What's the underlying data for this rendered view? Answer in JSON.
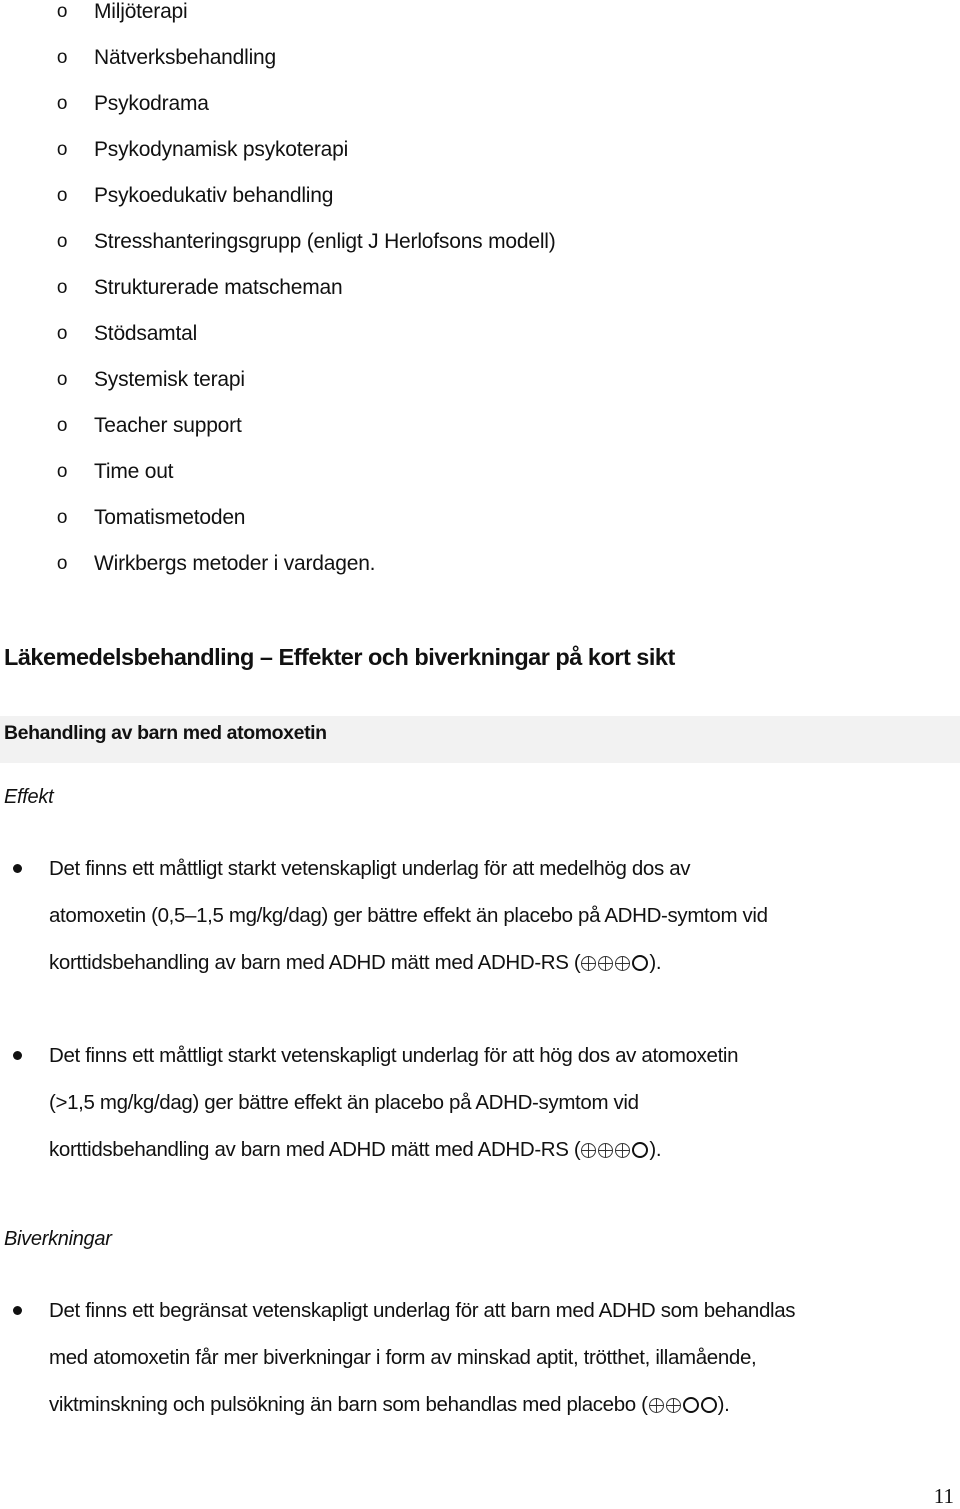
{
  "sublist": {
    "bullet_glyph": "o",
    "items": [
      "Miljöterapi",
      "Nätverksbehandling",
      "Psykodrama",
      "Psykodynamisk psykoterapi",
      "Psykoedukativ behandling",
      "Stresshanteringsgrupp (enligt J Herlofsons modell)",
      "Strukturerade matscheman",
      "Stödsamtal",
      "Systemisk terapi",
      "Teacher support",
      "Time out",
      "Tomatismetoden",
      "Wirkbergs metoder i vardagen."
    ]
  },
  "section": {
    "heading": "Läkemedelsbehandling – Effekter och biverkningar på kort sikt",
    "subheading": "Behandling av barn med atomoxetin",
    "band_color": "#f2f2f2",
    "effekt": {
      "label": "Effekt",
      "bullets": [
        {
          "lines": [
            "Det finns ett måttligt starkt vetenskapligt underlag för att medelhög dos av",
            "atomoxetin (0,5–1,5 mg/kg/dag) ger bättre effekt än placebo på ADHD-symtom vid",
            "korttidsbehandling av barn med ADHD mätt med ADHD-RS ("
          ],
          "evidence_grade": {
            "filled": 3,
            "empty": 1,
            "filled_symbol": "⊕",
            "empty_symbol": "O"
          },
          "suffix": ")."
        },
        {
          "lines": [
            "Det finns ett måttligt starkt vetenskapligt underlag för att hög dos av atomoxetin",
            "(>1,5 mg/kg/dag) ger bättre effekt än placebo på ADHD-symtom vid",
            "korttidsbehandling av barn med ADHD mätt med ADHD-RS ("
          ],
          "evidence_grade": {
            "filled": 3,
            "empty": 1,
            "filled_symbol": "⊕",
            "empty_symbol": "O"
          },
          "suffix": ")."
        }
      ]
    },
    "biverkningar": {
      "label": "Biverkningar",
      "bullets": [
        {
          "lines": [
            "Det finns ett begränsat vetenskapligt underlag för att barn med ADHD som behandlas",
            "med atomoxetin får mer biverkningar i form av minskad aptit, trötthet, illamående,",
            "viktminskning och pulsökning än barn som behandlas med placebo ("
          ],
          "evidence_grade": {
            "filled": 2,
            "empty": 2,
            "filled_symbol": "⊕",
            "empty_symbol": "O"
          },
          "suffix": ")."
        }
      ]
    }
  },
  "page_number": "11"
}
